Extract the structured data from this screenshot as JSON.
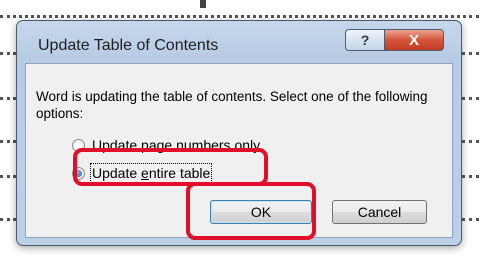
{
  "window": {
    "title": "Update Table of Contents",
    "help_glyph": "?",
    "close_glyph": "X"
  },
  "dialog": {
    "message": "Word is updating the table of contents.  Select one of the following options:",
    "options": [
      {
        "pre": "Update ",
        "mnemonic": "p",
        "post": "age numbers only",
        "selected": false
      },
      {
        "pre": "Update ",
        "mnemonic": "e",
        "post": "ntire table",
        "selected": true
      }
    ],
    "ok_label": "OK",
    "cancel_label": "Cancel"
  },
  "colors": {
    "annotation": "#e0102a",
    "frame": "#b6cbe4",
    "close_button": "#d5553b",
    "client_background": "#f0f0f0"
  },
  "icons": {
    "help": "help-icon",
    "close": "close-icon"
  }
}
